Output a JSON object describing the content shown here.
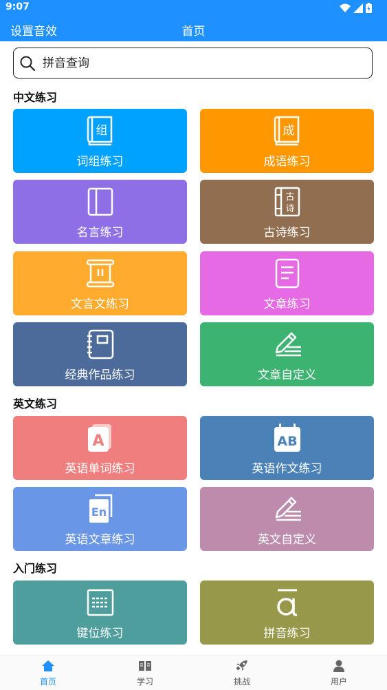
{
  "status": {
    "time": "9:07"
  },
  "appbar": {
    "left_action": "设置音效",
    "title": "首页"
  },
  "search": {
    "placeholder": "拼音查询"
  },
  "sections": {
    "chinese": "中文练习",
    "english": "英文练习",
    "intro": "入门练习"
  },
  "cards": [
    {
      "label": "词组练习",
      "icon": "book-zu-icon",
      "color": "#00a2ff"
    },
    {
      "label": "成语练习",
      "icon": "book-cheng-icon",
      "color": "#ff9800"
    },
    {
      "label": "名言练习",
      "icon": "panel-book-icon",
      "color": "#8e6fe6"
    },
    {
      "label": "古诗练习",
      "icon": "poem-scroll-icon",
      "color": "#926e50"
    },
    {
      "label": "文言文练习",
      "icon": "scroll-icon",
      "color": "#ffab2e"
    },
    {
      "label": "文章练习",
      "icon": "document-icon",
      "color": "#e56ae3"
    },
    {
      "label": "经典作品练习",
      "icon": "notebook-icon",
      "color": "#4d6b9a"
    },
    {
      "label": "文章自定义",
      "icon": "pencil-lines-icon",
      "color": "#3cb371"
    },
    {
      "label": "英语单词练习",
      "icon": "letter-a-card-icon",
      "color": "#f07e7e"
    },
    {
      "label": "英语作文练习",
      "icon": "ab-calendar-icon",
      "color": "#4a82b8"
    },
    {
      "label": "英语文章练习",
      "icon": "en-document-icon",
      "color": "#6a96e8"
    },
    {
      "label": "英文自定义",
      "icon": "pencil-lines-icon",
      "color": "#bd8cad"
    },
    {
      "label": "键位练习",
      "icon": "keyboard-icon",
      "color": "#4d9e9c"
    },
    {
      "label": "拼音练习",
      "icon": "pinyin-a-icon",
      "color": "#98984b"
    }
  ],
  "tabs": [
    {
      "label": "首页",
      "icon": "home-icon",
      "active": true
    },
    {
      "label": "学习",
      "icon": "open-book-icon",
      "active": false
    },
    {
      "label": "挑战",
      "icon": "rocket-icon",
      "active": false
    },
    {
      "label": "用户",
      "icon": "user-icon",
      "active": false
    }
  ]
}
